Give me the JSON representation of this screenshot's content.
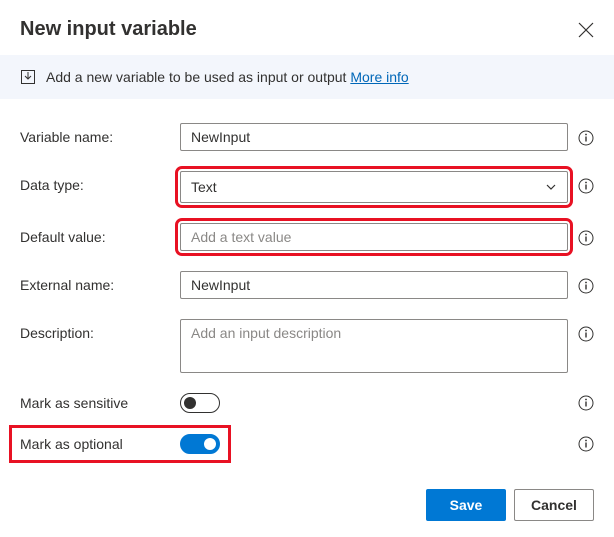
{
  "header": {
    "title": "New input variable"
  },
  "banner": {
    "text": "Add a new variable to be used as input or output ",
    "link_label": "More info"
  },
  "fields": {
    "variable_name": {
      "label": "Variable name:",
      "value": "NewInput"
    },
    "data_type": {
      "label": "Data type:",
      "value": "Text"
    },
    "default_value": {
      "label": "Default value:",
      "placeholder": "Add a text value"
    },
    "external_name": {
      "label": "External name:",
      "value": "NewInput"
    },
    "description": {
      "label": "Description:",
      "placeholder": "Add an input description"
    },
    "sensitive": {
      "label": "Mark as sensitive"
    },
    "optional": {
      "label": "Mark as optional"
    }
  },
  "buttons": {
    "save": "Save",
    "cancel": "Cancel"
  }
}
